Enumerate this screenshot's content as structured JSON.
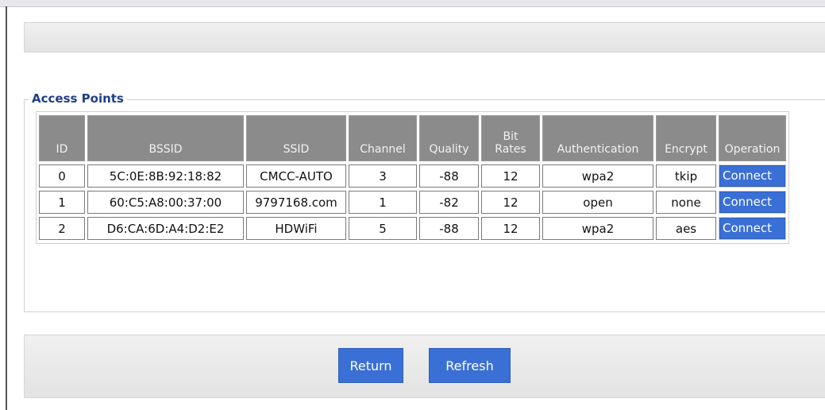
{
  "access_points": {
    "legend": "Access Points",
    "columns": [
      "ID",
      "BSSID",
      "SSID",
      "Channel",
      "Quality",
      "Bit Rates",
      "Authentication",
      "Encrypt",
      "Operation"
    ],
    "rows": [
      {
        "id": "0",
        "bssid": "5C:0E:8B:92:18:82",
        "ssid": "CMCC-AUTO",
        "channel": "3",
        "quality": "-88",
        "bit_rates": "12",
        "authentication": "wpa2",
        "encrypt": "tkip",
        "operation": "Connect"
      },
      {
        "id": "1",
        "bssid": "60:C5:A8:00:37:00",
        "ssid": "9797168.com",
        "channel": "1",
        "quality": "-82",
        "bit_rates": "12",
        "authentication": "open",
        "encrypt": "none",
        "operation": "Connect"
      },
      {
        "id": "2",
        "bssid": "D6:CA:6D:A4:D2:E2",
        "ssid": "HDWiFi",
        "channel": "5",
        "quality": "-88",
        "bit_rates": "12",
        "authentication": "wpa2",
        "encrypt": "aes",
        "operation": "Connect"
      }
    ]
  },
  "actions": {
    "return_label": "Return",
    "refresh_label": "Refresh"
  },
  "colors": {
    "legend_text": "#1f3d8a",
    "header_bg": "#8b8b8b",
    "button_bg": "#3a6fd6"
  }
}
